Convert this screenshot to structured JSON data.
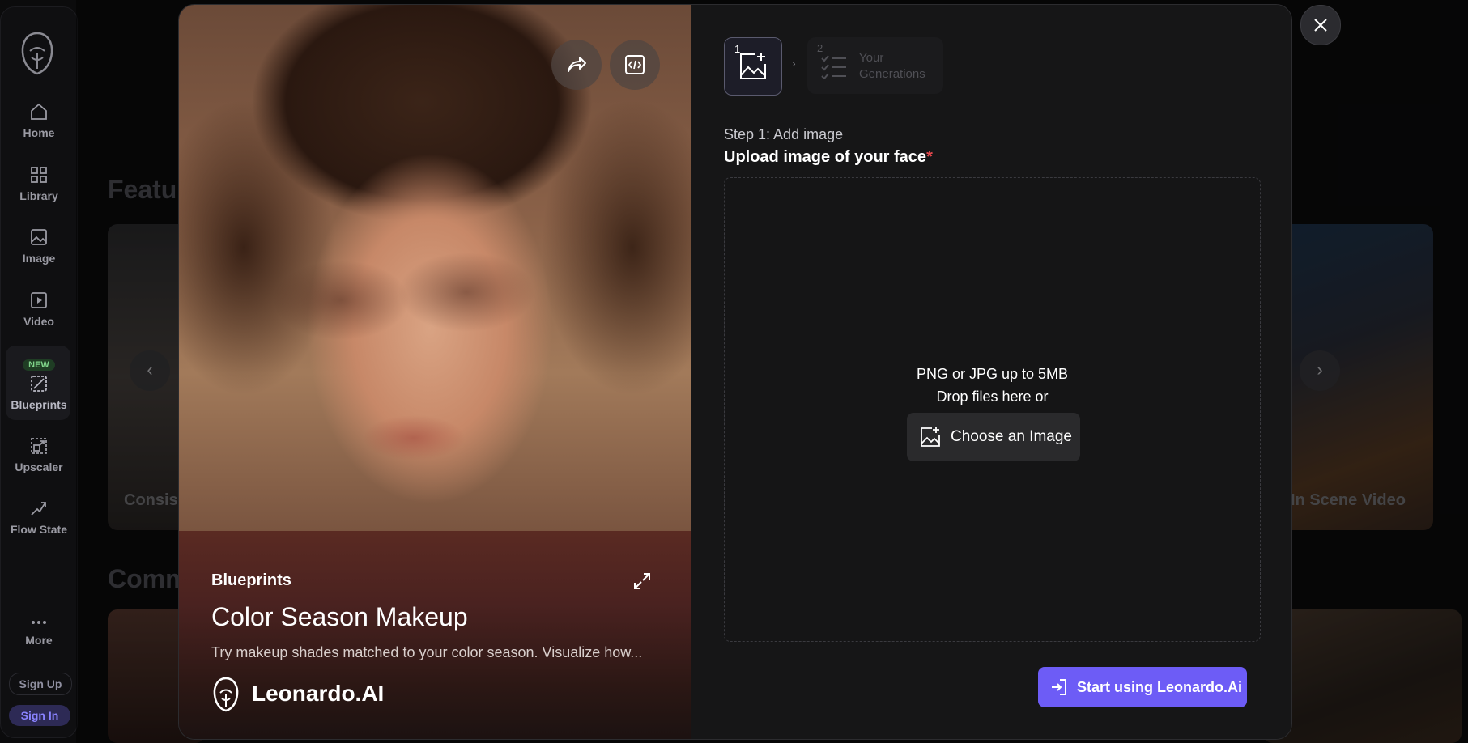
{
  "sidebar": {
    "items": [
      {
        "label": "Home",
        "icon": "home-icon"
      },
      {
        "label": "Library",
        "icon": "grid-icon"
      },
      {
        "label": "Image",
        "icon": "image-icon"
      },
      {
        "label": "Video",
        "icon": "video-icon"
      },
      {
        "label": "Blueprints",
        "icon": "blueprint-icon",
        "badge": "NEW"
      },
      {
        "label": "Upscaler",
        "icon": "upscaler-icon"
      },
      {
        "label": "Flow State",
        "icon": "flow-icon"
      },
      {
        "label": "More",
        "icon": "more-icon"
      }
    ],
    "sign_up": "Sign Up",
    "sign_in": "Sign In"
  },
  "background": {
    "featured_heading": "Featu",
    "community_heading": "Comm",
    "card_left_label": "Consis",
    "card_right_label": "In Scene Video"
  },
  "modal": {
    "blueprint": {
      "category": "Blueprints",
      "title": "Color Season Makeup",
      "description": "Try makeup shades matched to your color season. Visualize how...",
      "brand": "Leonardo.AI"
    },
    "steps": [
      {
        "number": "1",
        "icon": "add-image-icon"
      },
      {
        "number": "2",
        "label_line1": "Your",
        "label_line2": "Generations",
        "icon": "checklist-icon"
      }
    ],
    "step_label": "Step 1: Add image",
    "upload_title": "Upload image of your face",
    "required_mark": "*",
    "dropzone": {
      "formats": "PNG or JPG up to 5MB",
      "drop_text": "Drop files here or",
      "choose_button": "Choose an Image"
    },
    "start_button": "Start using Leonardo.Ai"
  },
  "colors": {
    "accent": "#6d5cf6",
    "required": "#e5484d",
    "badge_green": "#7fd38a"
  }
}
